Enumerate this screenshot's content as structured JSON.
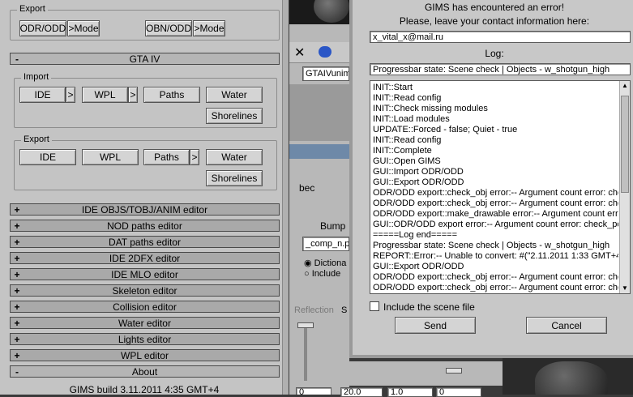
{
  "left_panel": {
    "export_top": {
      "label": "Export",
      "odr_button": "ODR/ODD",
      "odr_mode_button": ">Mode",
      "obn_button": "OBN/ODD",
      "obn_mode_button": ">Mode"
    },
    "gta_iv": {
      "title": "GTA IV",
      "sign": "-",
      "import_group": {
        "label": "Import",
        "ide": "IDE",
        "wpl": "WPL",
        "paths": "Paths",
        "water": "Water",
        "shorelines": "Shorelines",
        "arrow": ">"
      },
      "export_group": {
        "label": "Export",
        "ide": "IDE",
        "wpl": "WPL",
        "paths": "Paths",
        "water": "Water",
        "shorelines": "Shorelines",
        "arrow": ">"
      }
    },
    "rollouts": [
      {
        "sign": "+",
        "title": "IDE OBJS/TOBJ/ANIM editor"
      },
      {
        "sign": "+",
        "title": "NOD paths editor"
      },
      {
        "sign": "+",
        "title": "DAT paths editor"
      },
      {
        "sign": "+",
        "title": "IDE 2DFX editor"
      },
      {
        "sign": "+",
        "title": "IDE MLO editor"
      },
      {
        "sign": "+",
        "title": "Skeleton editor"
      },
      {
        "sign": "+",
        "title": "Collision editor"
      },
      {
        "sign": "+",
        "title": "Water editor"
      },
      {
        "sign": "+",
        "title": "Lights editor"
      },
      {
        "sign": "+",
        "title": "WPL editor"
      },
      {
        "sign": "-",
        "title": "About"
      }
    ],
    "build_text": "GIMS build 3.11.2011 4:35 GMT+4"
  },
  "background_app": {
    "close_glyph": "✕",
    "field_value": "GTAIVunim",
    "bec_text": "bec",
    "bump_label": "Bump",
    "map_field": "_comp_n.pn",
    "radio_dictionary": "Dictiona",
    "radio_include": "Include",
    "reflection_label": "Reflection",
    "s_label": "S",
    "bottom_values": [
      "0",
      "20.0",
      "1.0",
      "0"
    ]
  },
  "dialog": {
    "title": "GIMS has encountered an error!",
    "contact_prompt": "Please, leave your contact information here:",
    "contact_value": "x_vital_x@mail.ru",
    "log_label": "Log:",
    "state_value": "Progressbar state: Scene check | Objects - w_shotgun_high",
    "log_lines": [
      "INIT::Start",
      "INIT::Read config",
      "INIT::Check missing modules",
      "INIT::Load modules",
      "UPDATE::Forced - false; Quiet - true",
      "INIT::Read config",
      "INIT::Complete",
      "GUI::Open GIMS",
      "GUI::Import ODR/ODD",
      "GUI::Export ODR/ODD",
      "ODR/ODD export::check_obj error:-- Argument count error: che",
      "ODR/ODD export::check_obj error:-- Argument count error: che",
      "ODR/ODD export::make_drawable error:-- Argument count error",
      "GUI::ODR/ODD export error:-- Argument count error: check_po",
      "=====Log end=====",
      "Progressbar state: Scene check | Objects - w_shotgun_high",
      "REPORT::Error:-- Unable to convert: #(\"2.11.2011 1:33 GMT+4",
      "GUI::Export ODR/ODD",
      "ODR/ODD export::check_obj error:-- Argument count error: che",
      "ODR/ODD export::check_obj error:-- Argument count error: che"
    ],
    "include_scene_label": "Include the scene file",
    "include_scene_checked": false,
    "send_button": "Send",
    "cancel_button": "Cancel"
  }
}
